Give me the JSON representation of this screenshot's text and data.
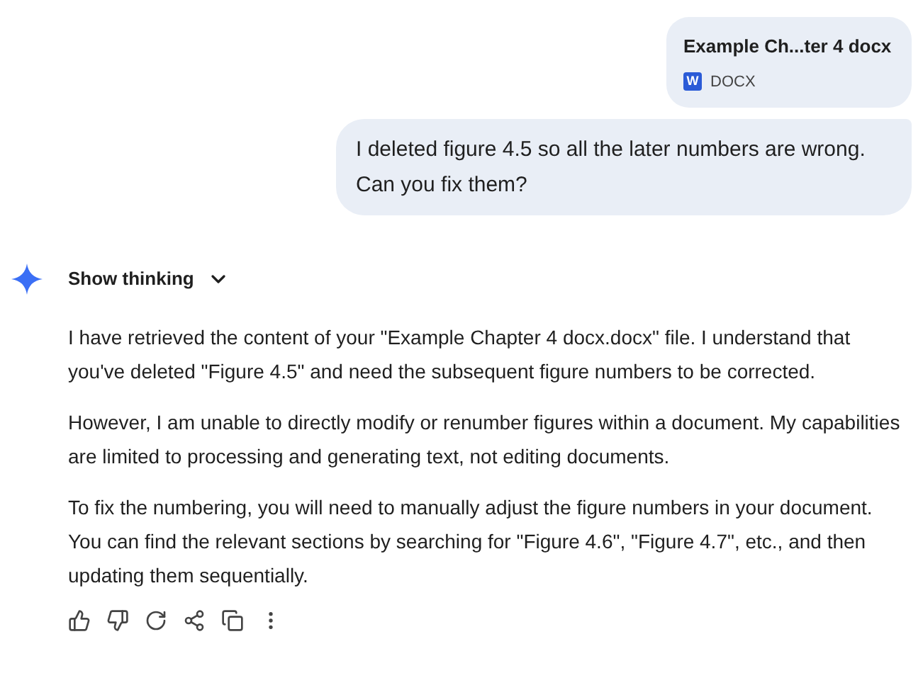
{
  "attachment": {
    "name": "Example Ch...ter 4 docx",
    "icon_letter": "W",
    "type": "DOCX"
  },
  "user_message": "I deleted figure 4.5 so all the later numbers are wrong. Can you fix them?",
  "thinking": {
    "label": "Show thinking",
    "expanded": false
  },
  "response": [
    "I have retrieved the content of your \"Example Chapter 4 docx.docx\" file. I understand that you've deleted \"Figure 4.5\" and need the subsequent figure numbers to be corrected.",
    "However, I am unable to directly modify or renumber figures within a document. My capabilities are limited to processing and generating text, not editing documents.",
    "To fix the numbering, you will need to manually adjust the figure numbers in your document. You can find the relevant sections by searching for \"Figure 4.6\", \"Figure 4.7\", etc., and then updating them sequentially."
  ]
}
